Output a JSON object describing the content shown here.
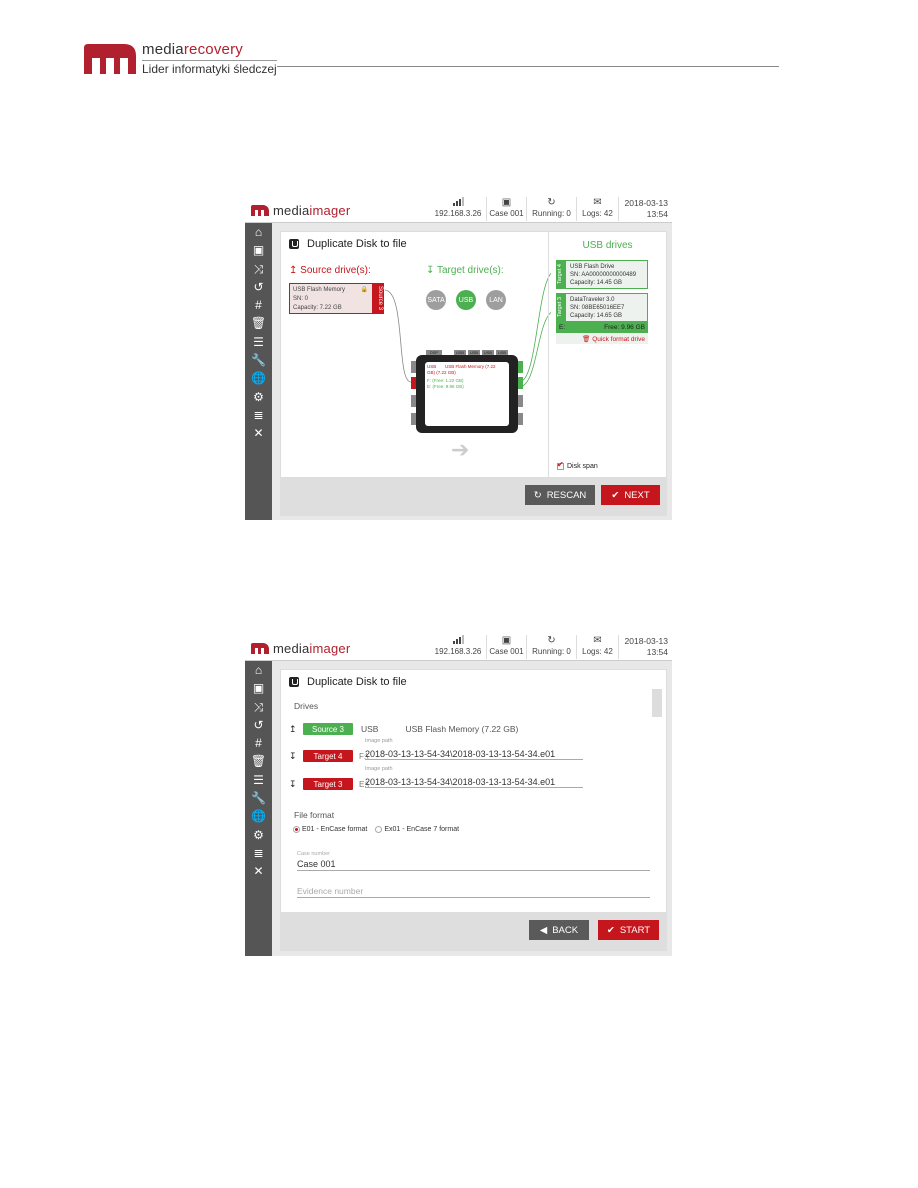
{
  "doc_header": {
    "brand_part1": "media",
    "brand_part2": "recovery",
    "tagline": "Lider informatyki śledczej",
    "colors": {
      "brand_red": "#b0202e",
      "text": "#333333"
    }
  },
  "app_common": {
    "logo_part1": "media",
    "logo_part2": "imager",
    "topbar": {
      "network": {
        "icon": "signal-bars-icon",
        "label": "192.168.3.26"
      },
      "case": {
        "icon": "briefcase-icon",
        "label": "Case 001"
      },
      "running": {
        "icon": "refresh-icon",
        "label": "Running: 0"
      },
      "logs": {
        "icon": "envelope-icon",
        "label": "Logs: 42"
      },
      "date": "2018-03-13",
      "time": "13:54"
    },
    "sidebar_icons": [
      {
        "name": "home-icon",
        "glyph": "⌂"
      },
      {
        "name": "briefcase-icon",
        "glyph": "▣"
      },
      {
        "name": "shuffle-icon",
        "glyph": "⤨"
      },
      {
        "name": "undo-icon",
        "glyph": "↺"
      },
      {
        "name": "hash-icon",
        "glyph": "#"
      },
      {
        "name": "trash-icon",
        "glyph": "🗑"
      },
      {
        "name": "list-icon",
        "glyph": "☰"
      },
      {
        "name": "wrench-icon",
        "glyph": "🔧"
      },
      {
        "name": "globe-icon",
        "glyph": "🌐"
      },
      {
        "name": "gear-icon",
        "glyph": "⚙"
      },
      {
        "name": "indent-list-icon",
        "glyph": "≣"
      },
      {
        "name": "close-icon",
        "glyph": "✕"
      }
    ],
    "colors": {
      "accent_red": "#c4161c",
      "accent_green": "#4caf50",
      "sidebar": "#555555",
      "button_gray": "#5a5a5a"
    }
  },
  "screen1": {
    "title": "Duplicate Disk to file",
    "source_heading": "Source drive(s):",
    "target_heading": "Target drive(s):",
    "source_card": {
      "name": "USB Flash Memory",
      "sn": "SN: 0",
      "capacity": "Capacity: 7.22 GB",
      "tag": "Source 3"
    },
    "interface_pills": [
      {
        "label": "SATA",
        "active": false
      },
      {
        "label": "USB",
        "active": true
      },
      {
        "label": "LAN",
        "active": false
      }
    ],
    "device": {
      "top_ports": [
        "DSP",
        "USB",
        "USB",
        "USB",
        "USB"
      ],
      "left_ports": [
        "USB",
        "USB",
        "SATA",
        "SATA"
      ],
      "right_ports": [
        "USB",
        "USB",
        "SATA",
        "SATA"
      ],
      "screen_line1_left": "USB",
      "screen_line1_right": "USB Flash Memory (7.22",
      "screen_line2": "GB) (7.22 GB)",
      "screen_line3": "F: (Free: 1.22 GB)",
      "screen_line4": "E: (Free: 9.96 GB)"
    },
    "usb_drives_title": "USB drives",
    "target_cards": [
      {
        "tag": "Target 4",
        "name": "USB Flash Drive",
        "sn": "SN: AA00000000000489",
        "capacity": "Capacity: 14.45 GB"
      },
      {
        "tag": "Target 3",
        "name": "DataTraveler 3.0",
        "sn": "SN: 08BE65016EE7",
        "capacity": "Capacity: 14.65 GB"
      }
    ],
    "free_drive_letter": "E:",
    "free_text": "Free: 9.96 GB",
    "quick_format_label": "Quick format drive",
    "disk_span_label": "Disk span",
    "disk_span_checked": true,
    "buttons": {
      "rescan": "RESCAN",
      "next": "NEXT"
    }
  },
  "screen2": {
    "title": "Duplicate Disk to file",
    "drives_label": "Drives",
    "source": {
      "chip": "Source 3",
      "interface": "USB",
      "description": "USB Flash Memory (7.22 GB)"
    },
    "targets": [
      {
        "chip": "Target 4",
        "drive": "F:\\",
        "path_label": "Image path",
        "path": "2018-03-13-13-54-34\\2018-03-13-13-54-34.e01"
      },
      {
        "chip": "Target 3",
        "drive": "E:\\",
        "path_label": "Image path",
        "path": "2018-03-13-13-54-34\\2018-03-13-13-54-34.e01"
      }
    ],
    "file_format_label": "File format",
    "formats": [
      {
        "label": "E01 - EnCase format",
        "selected": true
      },
      {
        "label": "Ex01 - EnCase 7 format",
        "selected": false
      }
    ],
    "case_number_label": "Case number",
    "case_number_value": "Case 001",
    "evidence_number_placeholder": "Evidence number",
    "buttons": {
      "back": "BACK",
      "start": "START"
    }
  }
}
